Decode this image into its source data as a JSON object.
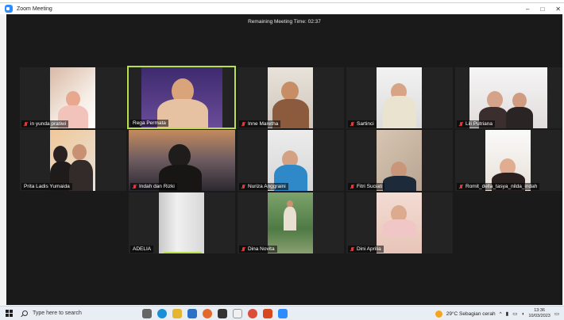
{
  "window": {
    "title": "Zoom Meeting",
    "controls": {
      "minimize": "–",
      "maximize": "□",
      "close": "✕"
    }
  },
  "meeting": {
    "remaining_label": "Remaining Meeting Time: 02:37",
    "participants": [
      {
        "name": "in yunda pratiwi",
        "muted": true
      },
      {
        "name": "Rega Permata",
        "muted": false,
        "active_speaker": true
      },
      {
        "name": "Inne Maretha",
        "muted": true
      },
      {
        "name": "Sartinci",
        "muted": true
      },
      {
        "name": "Lili Putriana",
        "muted": true
      },
      {
        "name": "Prita Ladis Yumaida",
        "muted": false
      },
      {
        "name": "Indah dan Rizki",
        "muted": true
      },
      {
        "name": "Nuriza Anggraini",
        "muted": true
      },
      {
        "name": "Fitri Suciati",
        "muted": true
      },
      {
        "name": "Romit_della_tasya_nilda_indah",
        "muted": true
      },
      {
        "name": "ADELIA",
        "muted": false
      },
      {
        "name": "Dina Novita",
        "muted": true
      },
      {
        "name": "Dini Aprilia",
        "muted": true
      }
    ]
  },
  "taskbar": {
    "search_placeholder": "Type here to search",
    "weather": "29°C  Sebagian cerah",
    "time": "13:36",
    "date": "10/03/2023",
    "apps": [
      "task-view-icon",
      "edge-icon",
      "file-explorer-icon",
      "mail-icon",
      "firefox-icon",
      "dropbox-icon",
      "amazon-icon",
      "chrome-icon",
      "office-icon",
      "zoom-icon"
    ]
  },
  "colors": {
    "speaker_border": "#b8e04a",
    "meeting_bg": "#1a1a1a",
    "muted_icon": "#e23b3b",
    "zoom_blue": "#2d8cff"
  }
}
